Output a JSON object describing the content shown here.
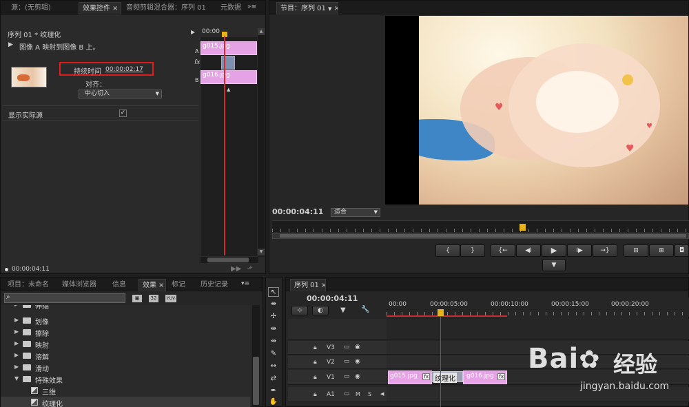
{
  "left_top_panel": {
    "tabs": [
      "源：(无剪辑)",
      "效果控件",
      "音频剪辑混合器：序列 01",
      "元数据"
    ],
    "active_tab_index": 1,
    "sequence_header": "序列 01 * 纹理化",
    "transition_desc": "图像 A 映射到图像 B 上。",
    "duration_label": "持续时间",
    "duration_value": "00:00:02:17",
    "align_label": "对齐：",
    "align_value": "中心切入",
    "show_source_label": "显示实际源",
    "show_source_checked": "✓",
    "mini_timeline_time": "00:00",
    "track_a_label": "A",
    "track_b_label": "B",
    "fx_label": "fx",
    "clip_a_name": "g015.jpg",
    "clip_b_name": "g016.jpg",
    "footer_time": "00:00:04:11"
  },
  "program_monitor": {
    "tab_label": "节目：序列 01",
    "timecode": "00:00:04:11",
    "zoom_value": "适合"
  },
  "project_panel": {
    "tabs": [
      "项目：未命名",
      "媒体浏览器",
      "信息",
      "效果",
      "标记",
      "历史记录"
    ],
    "active_tab_index": 3,
    "search_placeholder": "",
    "toolbar_labels": [
      "32",
      "YUV"
    ],
    "tree": [
      {
        "type": "folder",
        "label": "伸缩",
        "expanded": false
      },
      {
        "type": "folder",
        "label": "划像",
        "expanded": false
      },
      {
        "type": "folder",
        "label": "擦除",
        "expanded": false
      },
      {
        "type": "folder",
        "label": "映射",
        "expanded": false
      },
      {
        "type": "folder",
        "label": "溶解",
        "expanded": false
      },
      {
        "type": "folder",
        "label": "滑动",
        "expanded": false
      },
      {
        "type": "folder",
        "label": "特殊效果",
        "expanded": true
      },
      {
        "type": "preset",
        "label": "三维"
      },
      {
        "type": "preset",
        "label": "纹理化"
      }
    ]
  },
  "timeline": {
    "tab_label": "序列 01",
    "timecode": "00:00:04:11",
    "ruler": [
      "00:00",
      "00:00:05:00",
      "00:00:10:00",
      "00:00:15:00",
      "00:00:20:00"
    ],
    "tracks": [
      {
        "name": "V3"
      },
      {
        "name": "V2"
      },
      {
        "name": "V1"
      },
      {
        "name": "A1",
        "m": "M",
        "s": "S"
      }
    ],
    "clip_1": "g015.jpg",
    "clip_2": "g016.jpg",
    "transition_label": "纹理化",
    "fx_badge": "fx"
  },
  "watermark": {
    "brand": "Bai",
    "brand_cn": "经验",
    "url": "jingyan.baidu.com"
  },
  "colors": {
    "accent_yellow": "#e8b21a",
    "highlight_red": "#e01c1c",
    "clip_pink": "#e5a3e6",
    "playhead_red": "#d62a2a"
  }
}
